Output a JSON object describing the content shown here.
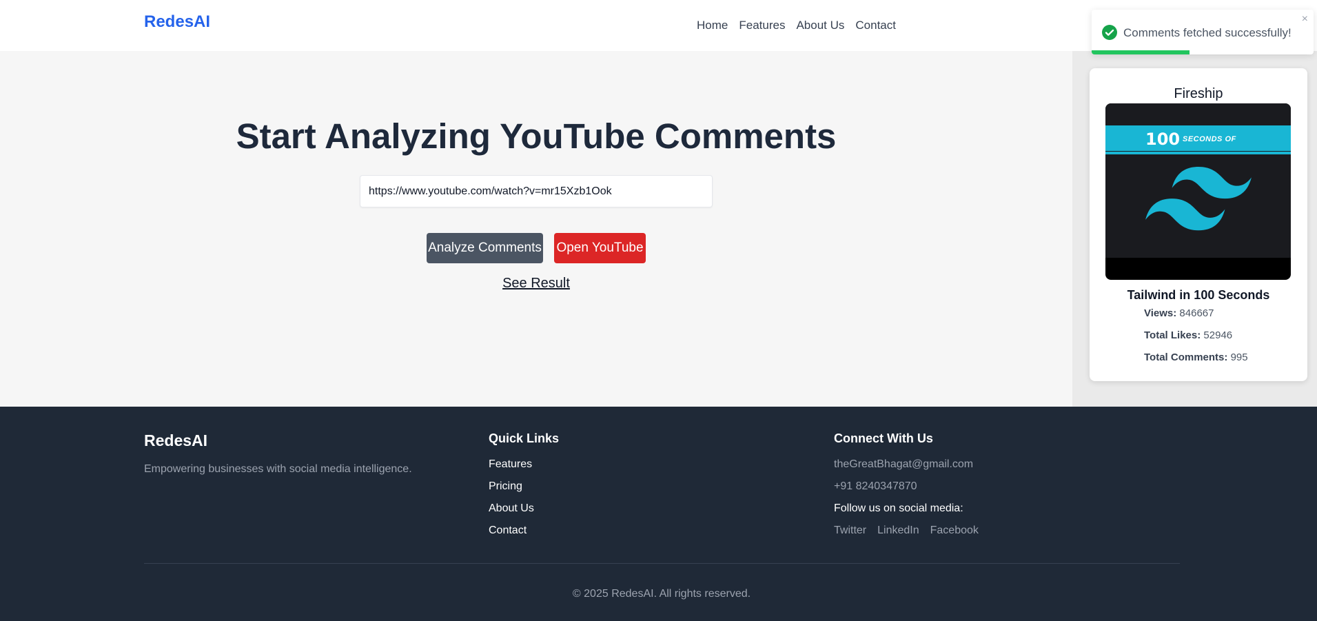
{
  "header": {
    "brand": "RedesAI",
    "nav": [
      "Home",
      "Features",
      "About Us",
      "Contact"
    ]
  },
  "main": {
    "headline": "Start Analyzing YouTube Comments",
    "url_value": "https://www.youtube.com/watch?v=mr15Xzb1Ook",
    "analyze_label": "Analyze Comments",
    "youtube_label": "Open YouTube",
    "see_result_label": "See Result"
  },
  "video": {
    "channel": "Fireship",
    "thumb_number": "100",
    "thumb_text": "SECONDS OF",
    "title": "Tailwind in 100 Seconds",
    "stats": [
      {
        "label": "Views:",
        "value": "846667"
      },
      {
        "label": "Total Likes:",
        "value": "52946"
      },
      {
        "label": "Total Comments:",
        "value": "995"
      }
    ]
  },
  "toast": {
    "message": "Comments fetched successfully!",
    "close": "×",
    "progress": 0.44,
    "icon": "check-circle-icon"
  },
  "footer": {
    "brand": "RedesAI",
    "tagline": "Empowering businesses with social media intelligence.",
    "quick_links_title": "Quick Links",
    "quick_links": [
      "Features",
      "Pricing",
      "About Us",
      "Contact"
    ],
    "connect_title": "Connect With Us",
    "email": "theGreatBhagat@gmail.com",
    "phone": "+91 8240347870",
    "follow_label": "Follow us on social media:",
    "socials": [
      "Twitter",
      "LinkedIn",
      "Facebook"
    ],
    "copyright": "© 2025 RedesAI. All rights reserved."
  },
  "colors": {
    "brand": "#2563eb",
    "analyze_button": "#4b5563",
    "youtube_button": "#dc2626",
    "footer_bg": "#1f2937",
    "toast_success": "#22c55e"
  }
}
